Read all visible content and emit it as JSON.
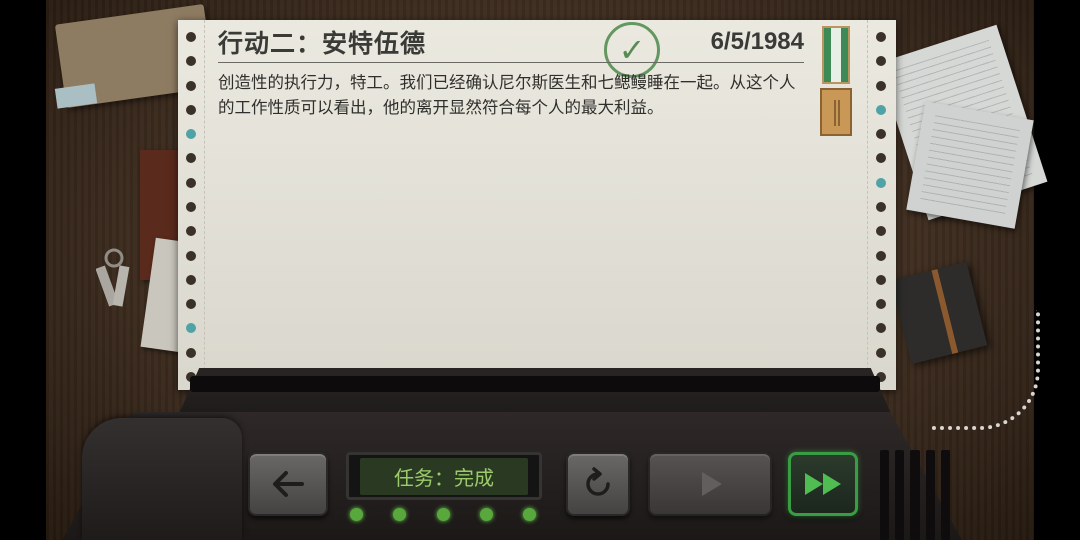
{
  "report": {
    "title": "行动二：安特伍德",
    "date": "6/5/1984",
    "body": "创造性的执行力，特工。我们已经确认尼尔斯医生和七鳃鳗睡在一起。从这个人的工作性质可以看出，他的离开显然符合每个人的最大利益。",
    "stamp_icon": "checkmark-icon",
    "medal_icon": "medal-ribbon-icon"
  },
  "controls": {
    "back_icon": "arrow-left-icon",
    "status_label": "任务：完成",
    "replay_icon": "replay-icon",
    "play_icon": "play-icon",
    "fast_forward_icon": "fast-forward-icon",
    "led_count": 5
  },
  "colors": {
    "paper": "#e7e5da",
    "status_text": "#9ccb6c",
    "accent_green": "#3a9c43",
    "stamp_green": "#4c8a4a"
  }
}
